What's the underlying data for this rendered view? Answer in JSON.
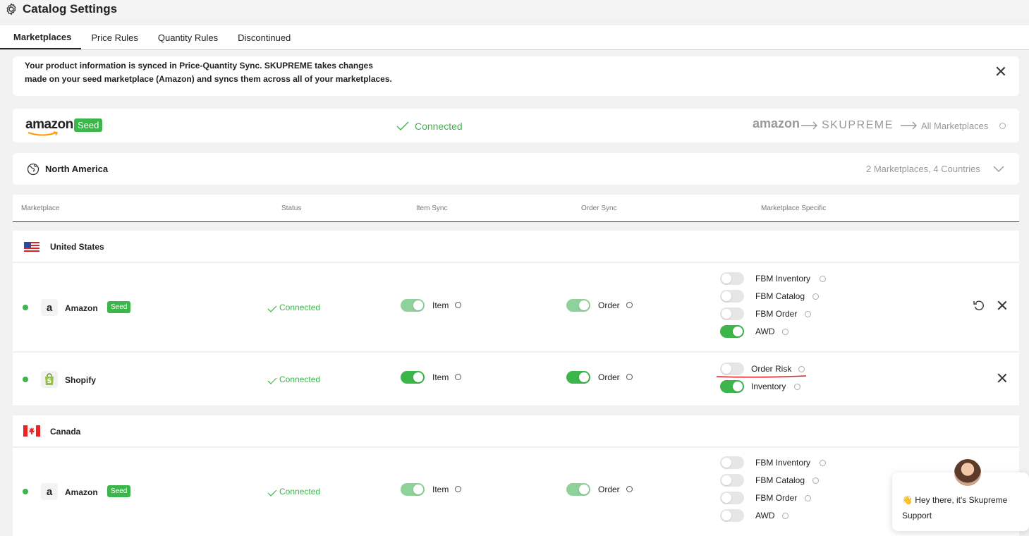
{
  "header": {
    "title": "Catalog Settings"
  },
  "tabs": [
    {
      "label": "Marketplaces",
      "active": true
    },
    {
      "label": "Price Rules"
    },
    {
      "label": "Quantity Rules"
    },
    {
      "label": "Discontinued"
    }
  ],
  "info": {
    "line1": "Your product information is synced in Price-Quantity Sync. SKUPREME takes changes",
    "line2": "made on your seed marketplace (Amazon) and syncs them across all of your marketplaces."
  },
  "seed": {
    "brand": "amazon",
    "badge": "Seed",
    "status": "Connected",
    "flow_from": "amazon",
    "flow_mid": "SKUPREME",
    "flow_to": "All Marketplaces"
  },
  "region": {
    "name": "North America",
    "summary": "2 Marketplaces, 4 Countries"
  },
  "table": {
    "headers": [
      "Marketplace",
      "Status",
      "Item Sync",
      "Order Sync",
      "Marketplace Specific"
    ],
    "countries": [
      {
        "name": "United States",
        "rows": [
          {
            "marketplace": "Amazon",
            "badge": "Seed",
            "status": "Connected",
            "item_label": "Item",
            "item_on": true,
            "order_label": "Order",
            "order_on": true,
            "specific": [
              {
                "label": "FBM Inventory",
                "on": false
              },
              {
                "label": "FBM Catalog",
                "on": false
              },
              {
                "label": "FBM Order",
                "on": false
              },
              {
                "label": "AWD",
                "on": true
              }
            ]
          },
          {
            "marketplace": "Shopify",
            "status": "Connected",
            "item_label": "Item",
            "item_on": true,
            "order_label": "Order",
            "order_on": true,
            "specific": [
              {
                "label": "Order Risk",
                "on": false
              },
              {
                "label": "Inventory",
                "on": true
              }
            ]
          }
        ]
      },
      {
        "name": "Canada",
        "rows": [
          {
            "marketplace": "Amazon",
            "badge": "Seed",
            "status": "Connected",
            "item_label": "Item",
            "item_on": true,
            "order_label": "Order",
            "order_on": true,
            "specific": [
              {
                "label": "FBM Inventory",
                "on": false
              },
              {
                "label": "FBM Catalog",
                "on": false
              },
              {
                "label": "FBM Order",
                "on": false
              },
              {
                "label": "AWD",
                "on": false
              }
            ]
          }
        ]
      }
    ]
  },
  "chat": {
    "emoji": "👋",
    "message": "Hey there, it's Skupreme Support"
  },
  "colors": {
    "accent": "#3cb54a",
    "accent_muted": "#8fd19a",
    "annotation": "#e02020"
  }
}
